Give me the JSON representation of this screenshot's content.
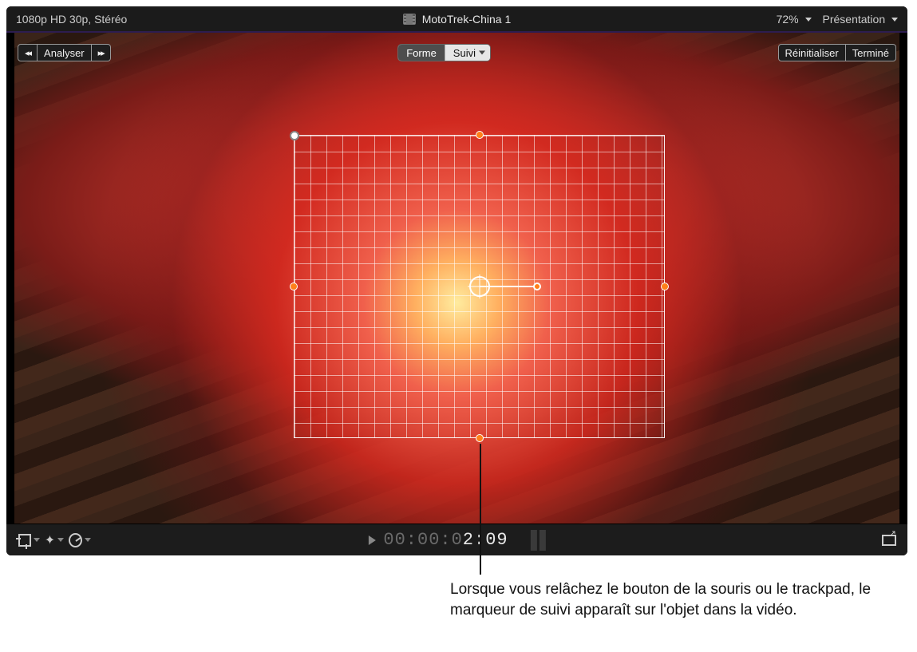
{
  "topbar": {
    "format": "1080p HD 30p, Stéréo",
    "clip_title": "MotoTrek-China 1",
    "zoom": "72%",
    "presentation": "Présentation"
  },
  "overlay": {
    "analyze": "Analyser",
    "shape": "Forme",
    "tracking": "Suivi",
    "reset": "Réinitialiser",
    "done": "Terminé"
  },
  "bottombar": {
    "timecode_gray": "00:00:0",
    "timecode_white": "2:09"
  },
  "callout": "Lorsque vous relâchez le bouton de la souris ou le trackpad, le marqueur de suivi apparaît sur l'objet dans la vidéo."
}
